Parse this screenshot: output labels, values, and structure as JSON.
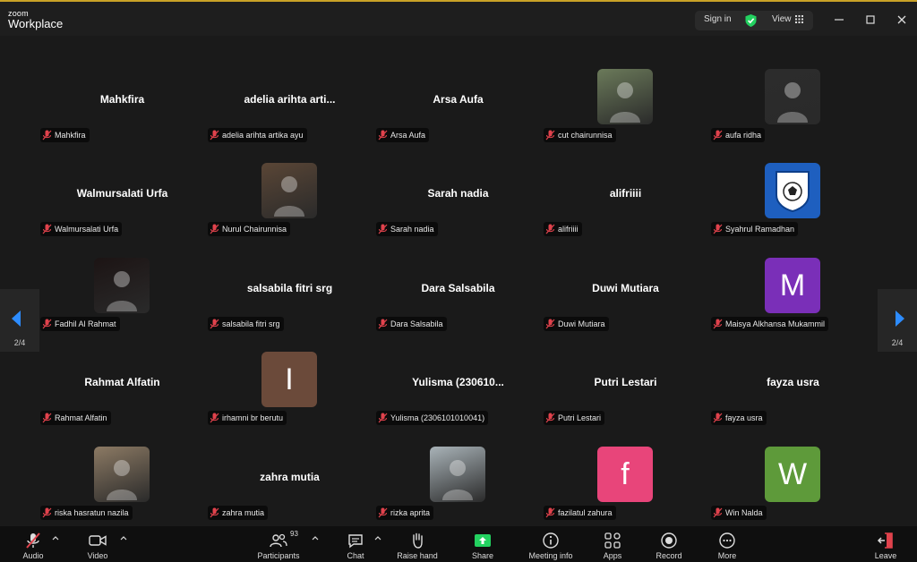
{
  "app": {
    "logo_small": "zoom",
    "logo_big": "Workplace"
  },
  "titlebar": {
    "sign_in": "Sign in",
    "view": "View"
  },
  "tiles": [
    {
      "name": "Mahkfira",
      "display": "Mahkfira",
      "avatar": "none"
    },
    {
      "name": "adelia arihta artika ayu",
      "display": "adelia arihta arti...",
      "avatar": "none"
    },
    {
      "name": "Arsa Aufa",
      "display": "Arsa Aufa",
      "avatar": "none"
    },
    {
      "name": "cut chairunnisa",
      "display": "",
      "avatar": "photo",
      "photo_color": "#6b7a5a"
    },
    {
      "name": "aufa ridha",
      "display": "",
      "avatar": "photo",
      "photo_color": "#2c2c2c"
    },
    {
      "name": "Walmursalati Urfa",
      "display": "Walmursalati Urfa",
      "avatar": "none"
    },
    {
      "name": "Nurul Chairunnisa",
      "display": "",
      "avatar": "photo",
      "photo_color": "#5a4636"
    },
    {
      "name": "Sarah nadia",
      "display": "Sarah nadia",
      "avatar": "none"
    },
    {
      "name": "alifriiii",
      "display": "alifriiii",
      "avatar": "none"
    },
    {
      "name": "Syahrul Ramadhan",
      "display": "",
      "avatar": "logo",
      "photo_color": "#1e5fbf"
    },
    {
      "name": "Fadhil Al Rahmat",
      "display": "",
      "avatar": "photo",
      "photo_color": "#1c1414"
    },
    {
      "name": "salsabila fitri srg",
      "display": "salsabila fitri srg",
      "avatar": "none"
    },
    {
      "name": "Dara Salsabila",
      "display": "Dara Salsabila",
      "avatar": "none"
    },
    {
      "name": "Duwi Mutiara",
      "display": "Duwi Mutiara",
      "avatar": "none"
    },
    {
      "name": "Maisya Alkhansa Mukammil",
      "display": "",
      "avatar": "letter",
      "letter": "M",
      "color": "#7a2fb8"
    },
    {
      "name": "Rahmat Alfatin",
      "display": "Rahmat Alfatin",
      "avatar": "none"
    },
    {
      "name": "irhamni br berutu",
      "display": "",
      "avatar": "letter",
      "letter": "I",
      "color": "#6b4a3a"
    },
    {
      "name": "Yulisma (2306101010041)",
      "display": "Yulisma  (230610...",
      "avatar": "none"
    },
    {
      "name": "Putri Lestari",
      "display": "Putri Lestari",
      "avatar": "none"
    },
    {
      "name": "fayza usra",
      "display": "fayza usra",
      "avatar": "none"
    },
    {
      "name": "riska hasratun nazila",
      "display": "",
      "avatar": "photo",
      "photo_color": "#8c7a64"
    },
    {
      "name": "zahra mutia",
      "display": "zahra mutia",
      "avatar": "none"
    },
    {
      "name": "rizka aprita",
      "display": "",
      "avatar": "photo",
      "photo_color": "#a9b3b8"
    },
    {
      "name": "fazilatul zahura",
      "display": "",
      "avatar": "letter",
      "letter": "f",
      "color": "#e8457a"
    },
    {
      "name": "Win Nalda",
      "display": "",
      "avatar": "letter",
      "letter": "W",
      "color": "#5e9a3a"
    }
  ],
  "pager": {
    "left": "2/4",
    "right": "2/4"
  },
  "toolbar": {
    "audio": "Audio",
    "video": "Video",
    "participants": "Participants",
    "participants_count": "93",
    "chat": "Chat",
    "raise_hand": "Raise hand",
    "share": "Share",
    "meeting_info": "Meeting info",
    "apps": "Apps",
    "record": "Record",
    "more": "More",
    "leave": "Leave"
  },
  "colors": {
    "accent_blue": "#2d8cff",
    "share_green": "#23d160",
    "mute_red": "#e0424c",
    "leave_red": "#e0424c"
  }
}
